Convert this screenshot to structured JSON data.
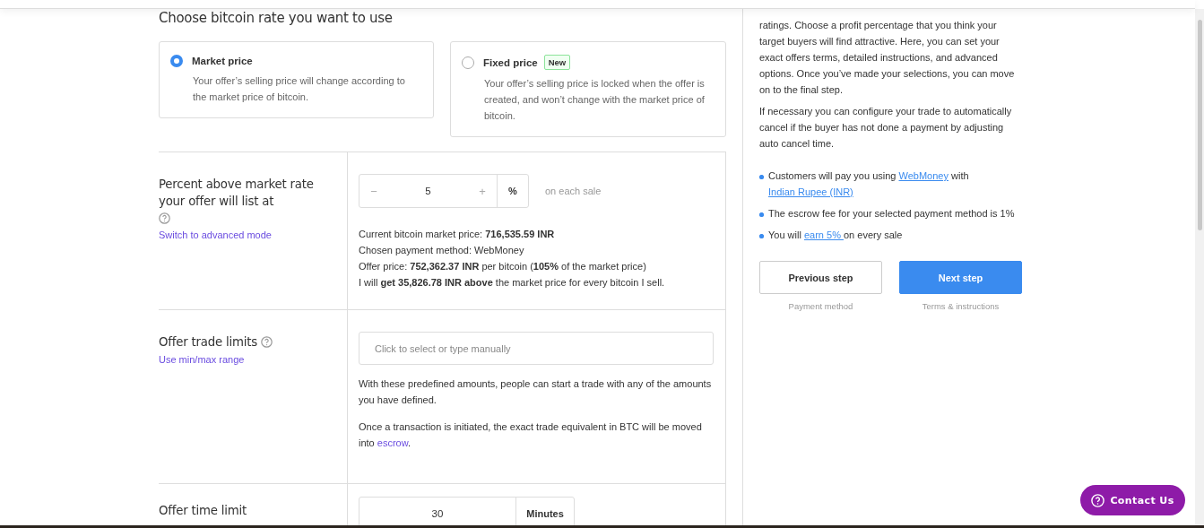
{
  "rate_section": {
    "title": "Choose bitcoin rate you want to use",
    "options": [
      {
        "label": "Market price",
        "selected": true,
        "description": "Your offer’s selling price will change according to the market price of bitcoin."
      },
      {
        "label": "Fixed price",
        "badge": "New",
        "selected": false,
        "description": "Your offer’s selling price is locked when the offer is created, and won’t change with the market price of bitcoin."
      }
    ]
  },
  "rows": [
    {
      "kind": "margin",
      "label": "Percent above market rate your offer will list at",
      "link": "Switch to advanced mode",
      "stepper": {
        "minus": "−",
        "value": "5",
        "plus": "+",
        "unit": "%"
      },
      "suffix": "on each sale",
      "lines": [
        "Current bitcoin market price: **716,535.59 INR**",
        "Chosen payment method: WebMoney",
        "Offer price: **752,362.37 INR** per bitcoin (**105%** of the market price)",
        "I will **get 35,826.78 INR above** the market price for every bitcoin I sell."
      ]
    },
    {
      "kind": "limits",
      "label": "Offer trade limits",
      "link": "Use min/max range",
      "field": {
        "placeholder": "Click to select or type manually"
      },
      "paragraphs": [
        [
          {
            "text": "With these predefined amounts, people can start a trade with any of the amounts you have defined.",
            "link": false
          }
        ],
        [
          {
            "text": "Once a transaction is initiated, the exact trade equivalent in BTC will be moved into ",
            "link": false
          },
          {
            "text": "escrow",
            "link": true
          },
          {
            "text": ".",
            "link": false
          }
        ]
      ]
    },
    {
      "kind": "time",
      "label": "Offer time limit",
      "stepper": {
        "value": "30",
        "unit": "Minutes"
      }
    }
  ],
  "side_panel": {
    "paragraphs": [
      "ratings. Choose a profit percentage that you think your target buyers will find attractive. Here, you can set your exact offers terms, detailed instructions, and advanced options. Once you’ve made your selections, you can move on to the final step.",
      "If necessary you can configure your trade to automatically cancel if the buyer has not done a payment by adjusting auto cancel time."
    ],
    "bullets": [
      [
        {
          "text": "Customers will pay you using ",
          "link": false
        },
        {
          "text": "WebMoney",
          "link": true
        },
        {
          "text": " with ",
          "link": false
        },
        {
          "text": "Indian Rupee (INR)",
          "link": true
        }
      ],
      [
        {
          "text": "The escrow fee for your selected payment method is 1%",
          "link": false
        }
      ],
      [
        {
          "text": "You will ",
          "link": false
        },
        {
          "text": "earn 5% ",
          "link": true
        },
        {
          "text": "on every sale",
          "link": false
        }
      ]
    ],
    "steps": [
      {
        "kind": "secondary",
        "label": "Previous step",
        "caption": "Payment method"
      },
      {
        "kind": "primary",
        "label": "Next step",
        "caption": "Terms & instructions"
      }
    ]
  },
  "contact_button": {
    "label": "Contact Us"
  }
}
